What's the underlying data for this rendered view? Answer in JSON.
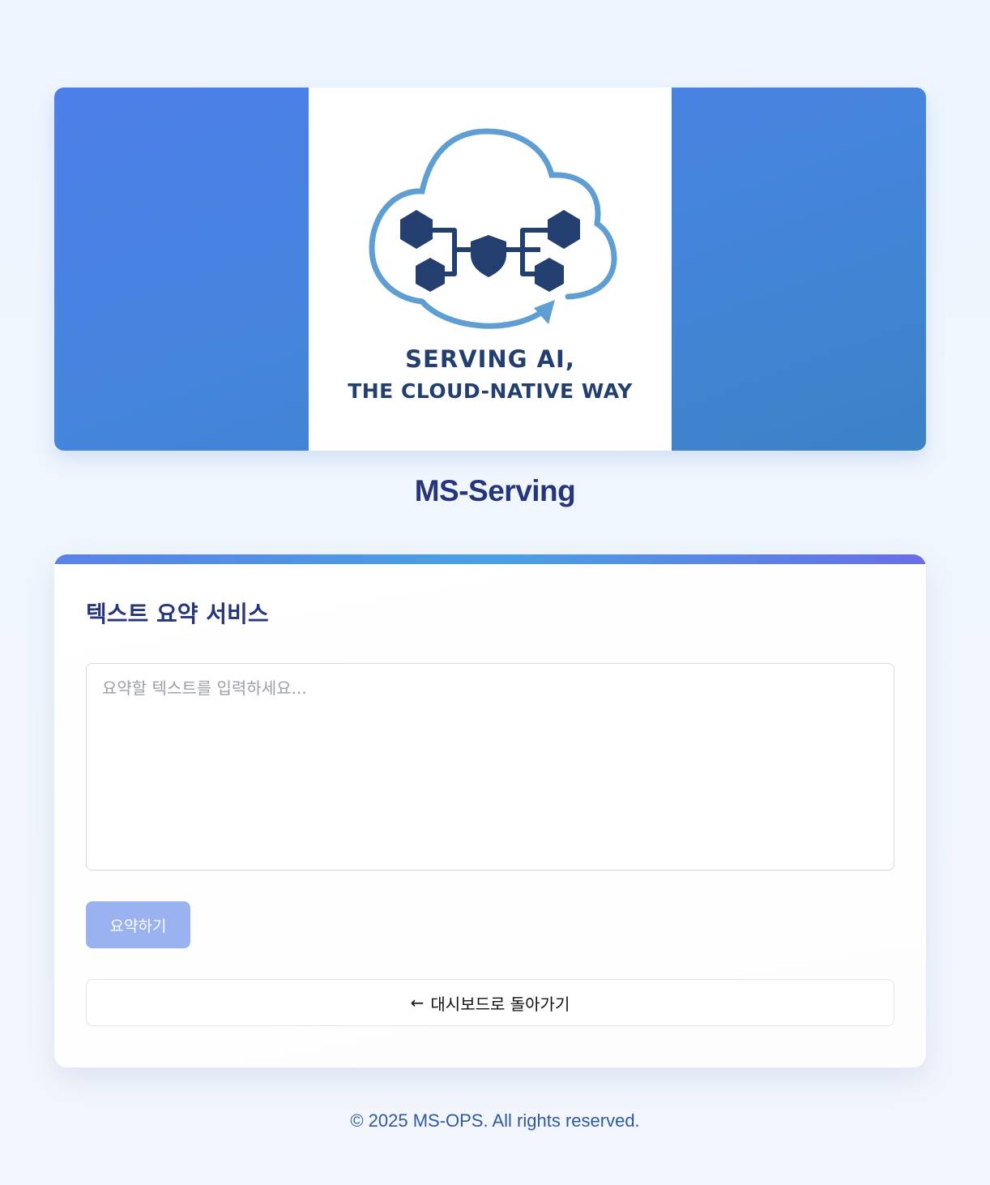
{
  "banner": {
    "logo_line_1": "SERVING AI,",
    "logo_line_2": "THE CLOUD-NATIVE WAY"
  },
  "app": {
    "title": "MS-Serving"
  },
  "summary_card": {
    "title": "텍스트 요약 서비스",
    "input_placeholder": "요약할 텍스트를 입력하세요...",
    "input_value": "",
    "submit_label": "요약하기",
    "submit_disabled": true,
    "back_arrow": "←",
    "back_label": "대시보드로 돌아가기"
  },
  "footer": {
    "text": "© 2025 MS-OPS. All rights reserved."
  },
  "colors": {
    "brand_navy": "#27367a",
    "logo_navy": "#233f70",
    "cloud_blue": "#5f9ed3",
    "banner_blue": "#4585dd",
    "button_disabled": "#9bb2f1",
    "footer_text": "#2f5b9a"
  },
  "icons": {
    "back": "arrow-left-icon",
    "logo": "cloud-network-logo"
  }
}
